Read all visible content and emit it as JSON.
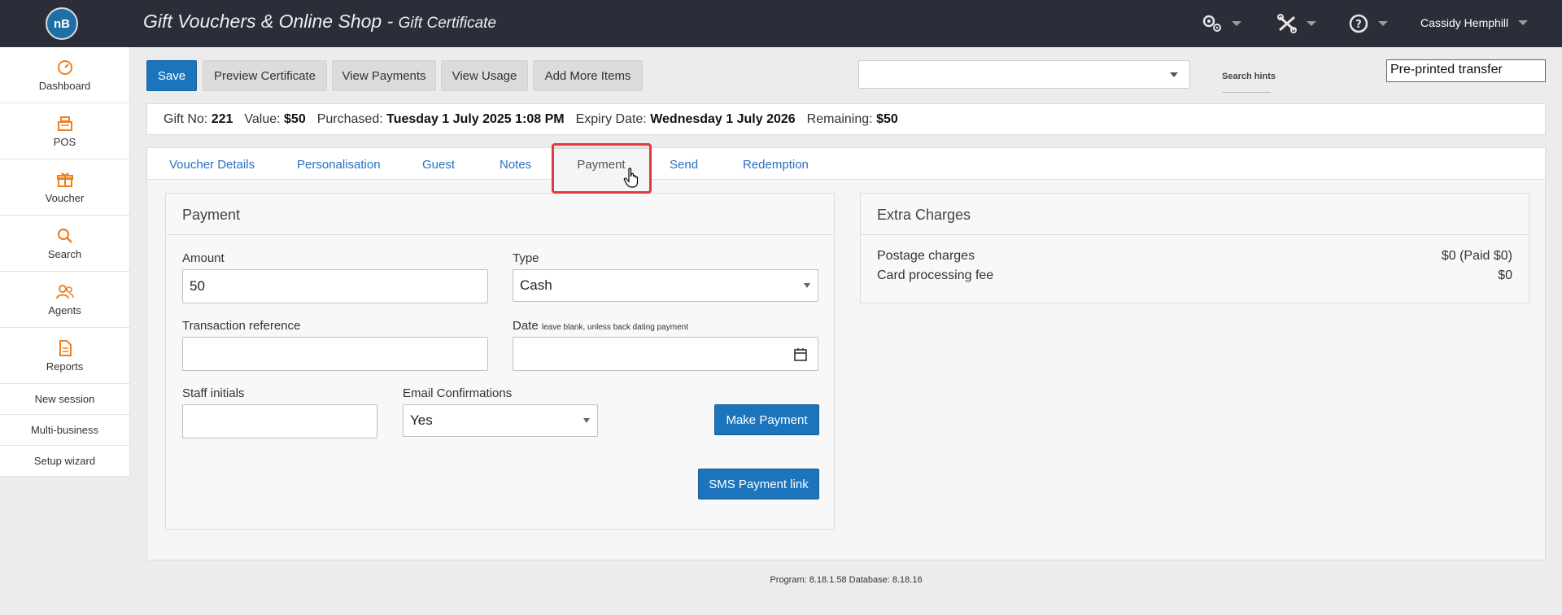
{
  "header": {
    "logo_text": "nB",
    "title": "Gift Vouchers & Online Shop",
    "separator": " - ",
    "subtitle": "Gift Certificate",
    "icons": [
      "settings-icon",
      "tools-icon",
      "help-icon"
    ],
    "user_name": "Cassidy Hemphill"
  },
  "sidebar": {
    "items": [
      {
        "label": "Dashboard",
        "icon": "dashboard-icon"
      },
      {
        "label": "POS",
        "icon": "register-icon"
      },
      {
        "label": "Voucher",
        "icon": "gift-icon"
      },
      {
        "label": "Search",
        "icon": "search-icon"
      },
      {
        "label": "Agents",
        "icon": "agents-icon"
      },
      {
        "label": "Reports",
        "icon": "reports-icon"
      }
    ],
    "links": [
      "New session",
      "Multi-business",
      "Setup wizard"
    ]
  },
  "toolbar": {
    "save": "Save",
    "preview": "Preview Certificate",
    "view_payments": "View Payments",
    "view_usage": "View Usage",
    "add_items": "Add More Items",
    "search_value": "",
    "search_hints": "Search hints",
    "preprinted": "Pre-printed transfer"
  },
  "info": {
    "gift_no_label": "Gift No:",
    "gift_no": "221",
    "value_label": "Value:",
    "value": "$50",
    "purchased_label": "Purchased:",
    "purchased": "Tuesday 1 July 2025 1:08 PM",
    "expiry_label": "Expiry Date:",
    "expiry": "Wednesday 1 July 2026",
    "remaining_label": "Remaining:",
    "remaining": "$50"
  },
  "tabs": [
    "Voucher Details",
    "Personalisation",
    "Guest",
    "Notes",
    "Payment",
    "Send",
    "Redemption"
  ],
  "active_tab": "Payment",
  "payment": {
    "title": "Payment",
    "amount_label": "Amount",
    "amount_value": "50",
    "type_label": "Type",
    "type_value": "Cash",
    "txn_label": "Transaction reference",
    "txn_value": "",
    "date_label": "Date",
    "date_hint": "leave blank, unless back dating payment",
    "date_value": "",
    "staff_label": "Staff initials",
    "staff_value": "",
    "email_label": "Email Confirmations",
    "email_value": "Yes",
    "make_payment": "Make Payment",
    "sms_link": "SMS Payment link"
  },
  "extra": {
    "title": "Extra Charges",
    "rows": [
      {
        "label": "Postage charges",
        "value": "$0 (Paid $0)"
      },
      {
        "label": "Card processing fee",
        "value": "$0"
      }
    ]
  },
  "footer": "Program: 8.18.1.58 Database: 8.18.16",
  "colors": {
    "accent": "#1c75bc",
    "topbar": "#2b2d38",
    "sidebar_icon": "#f07f1e",
    "highlight": "#e0393e",
    "link": "#2a6fc0"
  }
}
